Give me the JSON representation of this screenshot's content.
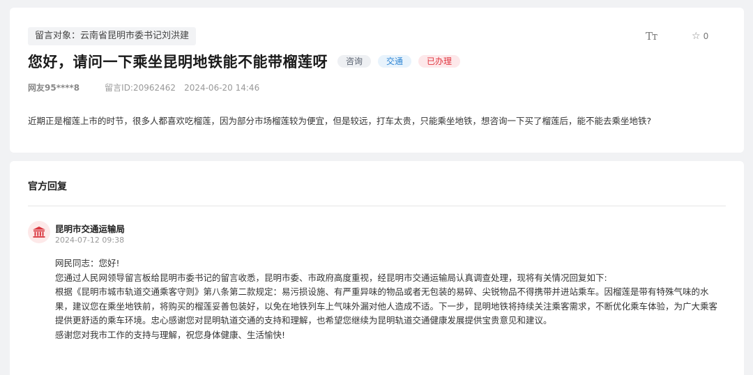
{
  "post": {
    "target_label": "留言对象：云南省昆明市委书记刘洪建",
    "title": "您好，请问一下乘坐昆明地铁能不能带榴莲呀",
    "tags": [
      "咨询",
      "交通",
      "已办理"
    ],
    "author": "网友95****8",
    "message_id": "留言ID:20962462",
    "datetime": "2024-06-20 14:46",
    "content": "近期正是榴莲上市的时节，很多人都喜欢吃榴莲，因为部分市场榴莲较为便宜，但是较远，打车太贵，只能乘坐地铁，想咨询一下买了榴莲后，能不能去乘坐地铁?",
    "toolbar": {
      "font_size_icon": "font-size-icon",
      "font_size_glyph": "Tт",
      "star_icon": "star-icon",
      "favorite_count": "0"
    }
  },
  "reply": {
    "section_title": "官方回复",
    "department": "昆明市交通运输局",
    "department_icon": "government-building-icon",
    "datetime": "2024-07-12 09:38",
    "paragraphs": [
      "网民同志：您好!",
      "您通过人民网领导留言板给昆明市委书记的留言收悉，昆明市委、市政府高度重视，经昆明市交通运输局认真调查处理，现将有关情况回复如下:",
      "根据《昆明市城市轨道交通乘客守则》第八条第二款规定：易污损设施、有严重异味的物品或者无包装的易碎、尖锐物品不得携带并进站乘车。因榴莲是带有特殊气味的水果，建议您在乘坐地铁前，将购买的榴莲妥善包装好，以免在地铁列车上气味外漏对他人造成不适。下一步，昆明地铁将持续关注乘客需求，不断优化乘车体验，为广大乘客提供更舒适的乘车环境。忠心感谢您对昆明轨道交通的支持和理解，也希望您继续为昆明轨道交通健康发展提供宝贵意见和建议。",
      "感谢您对我市工作的支持与理解，祝您身体健康、生活愉快!"
    ]
  },
  "colors": {
    "page_bg": "#f1f2f4",
    "tag_consult": "#5a6270",
    "tag_traffic": "#2f86d4",
    "tag_done": "#e0353f",
    "dept_icon": "#d9363e"
  }
}
